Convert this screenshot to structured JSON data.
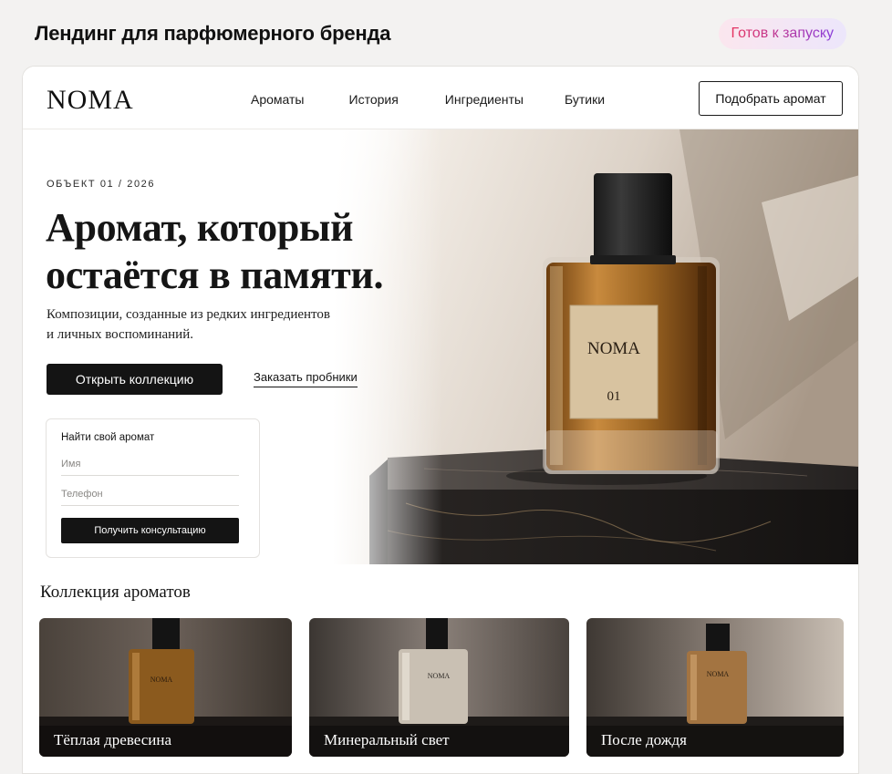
{
  "page": {
    "title": "Лендинг для парфюмерного бренда",
    "status_badge": "Готов к запуску"
  },
  "nav": {
    "logo": "NOMA",
    "links": [
      "Ароматы",
      "История",
      "Ингредиенты",
      "Бутики"
    ],
    "cta": "Подобрать аромат"
  },
  "hero": {
    "eyebrow": "ОБЪЕКТ 01 / 2026",
    "title_line1": "Аромат, который",
    "title_line2": "остаётся в памяти.",
    "subtitle_line1": "Композиции, созданные из редких ингредиентов",
    "subtitle_line2": "и личных воспоминаний.",
    "primary_button": "Открыть коллекцию",
    "secondary_link": "Заказать пробники",
    "bottle_label_brand": "NOMA",
    "bottle_label_number": "01"
  },
  "form": {
    "title": "Найти свой аромат",
    "name_placeholder": "Имя",
    "phone_placeholder": "Телефон",
    "submit": "Получить консультацию"
  },
  "collection": {
    "title": "Коллекция ароматов",
    "items": [
      {
        "label": "Тёплая древесина",
        "bottle_label": "NOMA",
        "liquid": "#7a4a16"
      },
      {
        "label": "Минеральный свет",
        "bottle_label": "NOMA",
        "liquid": "#b9b1a4"
      },
      {
        "label": "После дождя",
        "bottle_label": "NOMA",
        "liquid": "#8f6431"
      }
    ]
  },
  "colors": {
    "accent_dark": "#141414",
    "badge_gradient_start": "#e6335f",
    "badge_gradient_end": "#8a3ddb"
  }
}
